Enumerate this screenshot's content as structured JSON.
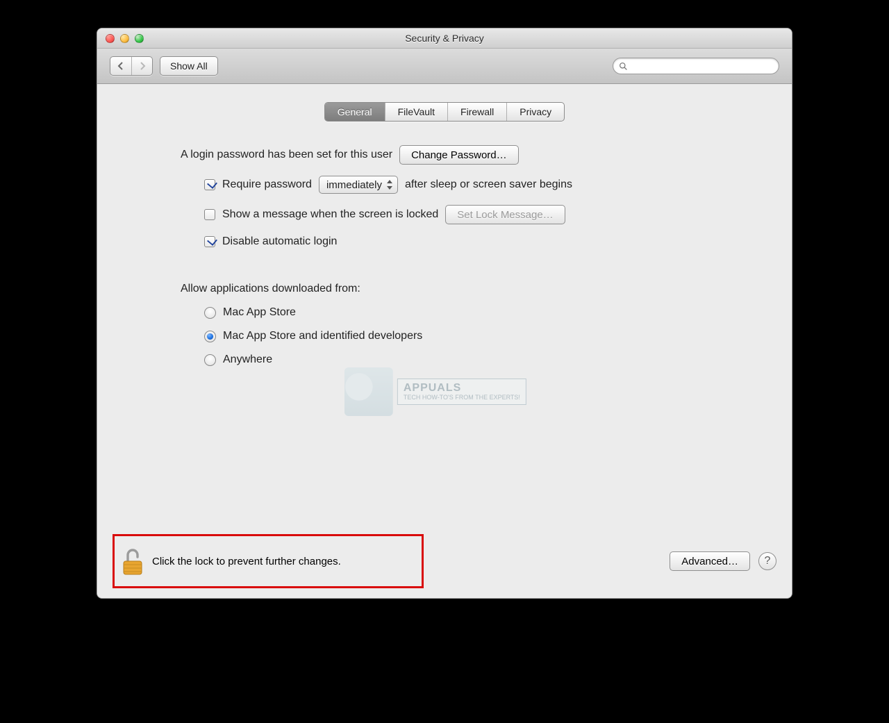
{
  "window": {
    "title": "Security & Privacy"
  },
  "toolbar": {
    "show_all_label": "Show All",
    "search_placeholder": ""
  },
  "tabs": {
    "general": "General",
    "filevault": "FileVault",
    "firewall": "Firewall",
    "privacy": "Privacy"
  },
  "login": {
    "set_text": "A login password has been set for this user",
    "change_password_label": "Change Password…",
    "require_password_label": "Require password",
    "require_password_delay": "immediately",
    "after_sleep_label": "after sleep or screen saver begins",
    "show_message_label": "Show a message when the screen is locked",
    "set_lock_message_label": "Set Lock Message…",
    "disable_autologin_label": "Disable automatic login"
  },
  "gatekeeper": {
    "section_label": "Allow applications downloaded from:",
    "option1": "Mac App Store",
    "option2": "Mac App Store and identified developers",
    "option3": "Anywhere"
  },
  "footer": {
    "lock_text": "Click the lock to prevent further changes.",
    "advanced_label": "Advanced…",
    "help": "?"
  },
  "watermark": {
    "brand": "APPUALS",
    "tagline": "TECH HOW-TO'S FROM THE EXPERTS!"
  }
}
